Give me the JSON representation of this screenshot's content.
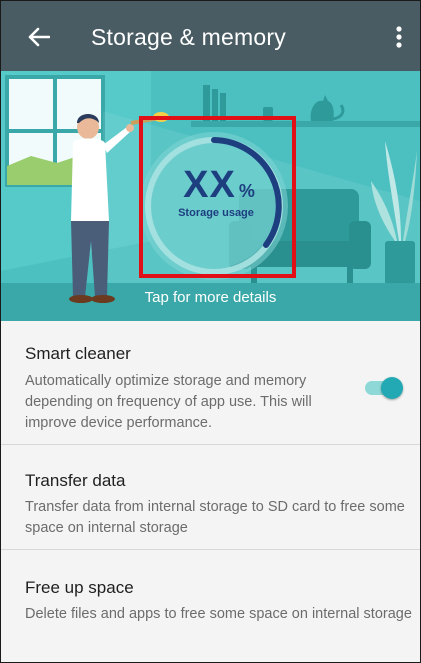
{
  "appbar": {
    "title": "Storage & memory",
    "back_icon": "arrow-left-icon",
    "more_icon": "more-vert-icon"
  },
  "hero": {
    "usage_value": "XX",
    "usage_unit": "%",
    "usage_label": "Storage usage",
    "details_link": "Tap for more details",
    "colors": {
      "background": "#4cc0c0",
      "ring": "#1d3f80",
      "highlight": "#e10f16"
    }
  },
  "settings": [
    {
      "title": "Smart cleaner",
      "description": "Automatically optimize storage and memory depending on frequency of app use. This will improve device performance.",
      "toggle": true
    },
    {
      "title": "Transfer data",
      "description": "Transfer data from internal storage to SD card to free some space on internal storage"
    },
    {
      "title": "Free up space",
      "description": "Delete files and apps to free some space on internal storage"
    }
  ],
  "colors": {
    "appbar": "#495c63",
    "accent": "#23a9b3"
  }
}
